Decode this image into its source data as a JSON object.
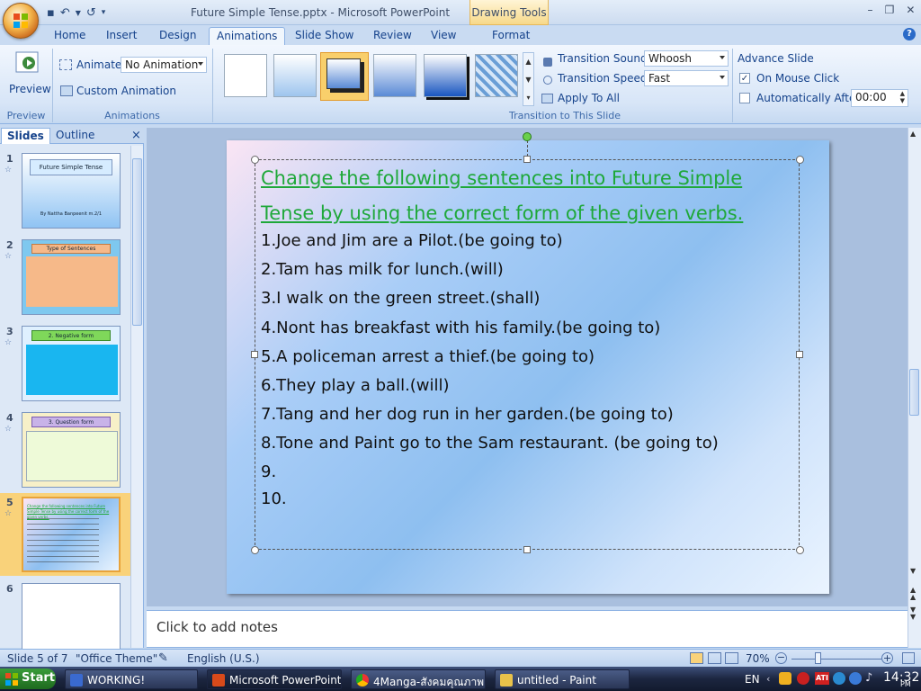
{
  "window": {
    "title": "Future Simple Tense.pptx - Microsoft PowerPoint",
    "context_tab": "Drawing Tools"
  },
  "tabs": [
    "Home",
    "Insert",
    "Design",
    "Animations",
    "Slide Show",
    "Review",
    "View",
    "Format"
  ],
  "ribbon": {
    "preview": {
      "label": "Preview",
      "group": "Preview"
    },
    "animations": {
      "animate_label": "Animate:",
      "animate_value": "No Animation",
      "custom_animation": "Custom Animation",
      "group": "Animations"
    },
    "transition": {
      "sound_label": "Transition Sound:",
      "sound_value": "Whoosh",
      "speed_label": "Transition Speed:",
      "speed_value": "Fast",
      "apply_all": "Apply To All",
      "group": "Transition to This Slide"
    },
    "advance": {
      "title": "Advance Slide",
      "on_click": "On Mouse Click",
      "on_click_checked": true,
      "auto_after": "Automatically After:",
      "auto_after_checked": false,
      "auto_value": "00:00"
    }
  },
  "slides_pane": {
    "tab_slides": "Slides",
    "tab_outline": "Outline",
    "close": "×",
    "thumbs": [
      {
        "num": "1",
        "title": "Future Simple Tense",
        "sub": "By Nattha Banpeenit m.2/1"
      },
      {
        "num": "2",
        "title": "Type of Sentences"
      },
      {
        "num": "3",
        "title": "2. Negative form"
      },
      {
        "num": "4",
        "title": "3. Question form"
      },
      {
        "num": "5",
        "title": "Change the following sentences into Future Simple Tense by using the correct form of the given verbs."
      },
      {
        "num": "6"
      }
    ]
  },
  "slide": {
    "heading": "Change the following sentences into Future Simple Tense by using the correct form of the  given verbs.",
    "lines": [
      "1.Joe and Jim are a Pilot.(be going to)",
      "2.Tam has milk for lunch.(will)",
      "3.I walk on the green street.(shall)",
      "4.Nont has breakfast with  his family.(be going to)",
      "5.A policeman arrest a thief.(be going to)",
      "6.They play a ball.(will)",
      "7.Tang and her dog run in her garden.(be going to)",
      "8.Tone and Paint go to the Sam restaurant. (be going to)",
      "9.",
      "10."
    ]
  },
  "notes_placeholder": "Click to add notes",
  "status": {
    "slide": "Slide 5 of 7",
    "theme": "\"Office Theme\"",
    "language": "English (U.S.)",
    "zoom": "70%"
  },
  "taskbar": {
    "start": "Start",
    "tasks": [
      "WORKING!",
      "Microsoft PowerPoint ...",
      "4Manga-สังคมคุณภาพ...",
      "untitled - Paint"
    ],
    "lang": "EN",
    "time": "14:32",
    "ampm": "PM"
  }
}
